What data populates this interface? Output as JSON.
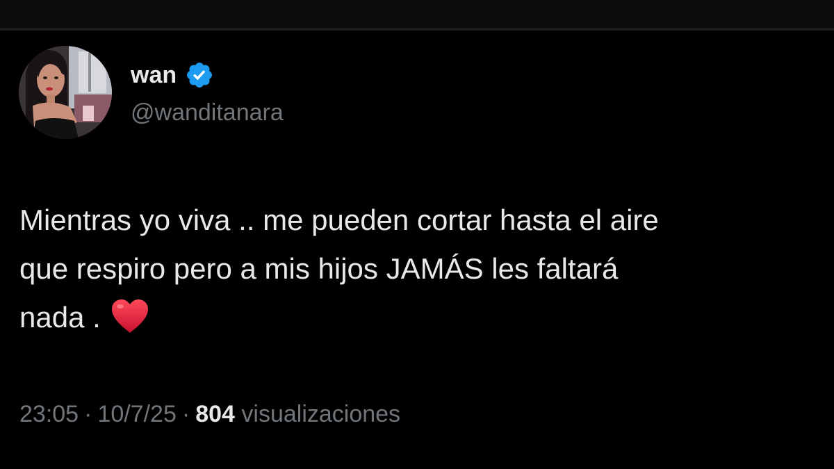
{
  "tweet": {
    "author": {
      "display_name": "wan",
      "handle": "@wanditanara",
      "verified_icon": "verified-badge-icon",
      "avatar": "profile-photo"
    },
    "text_lines": [
      "Mientras yo viva .. me pueden cortar hasta el aire",
      "que respiro pero a mis hijos JAMÁS les faltará",
      "nada ."
    ],
    "emoji": "heart-icon",
    "meta": {
      "time": "23:05",
      "separator": "·",
      "date": "10/7/25",
      "views_count": "804",
      "views_label": "visualizaciones"
    }
  },
  "colors": {
    "background": "#000000",
    "primary_text": "#e7e9ea",
    "secondary_text": "#71767b",
    "verified_blue": "#1d9bf0",
    "heart_red": "#e0182d"
  }
}
